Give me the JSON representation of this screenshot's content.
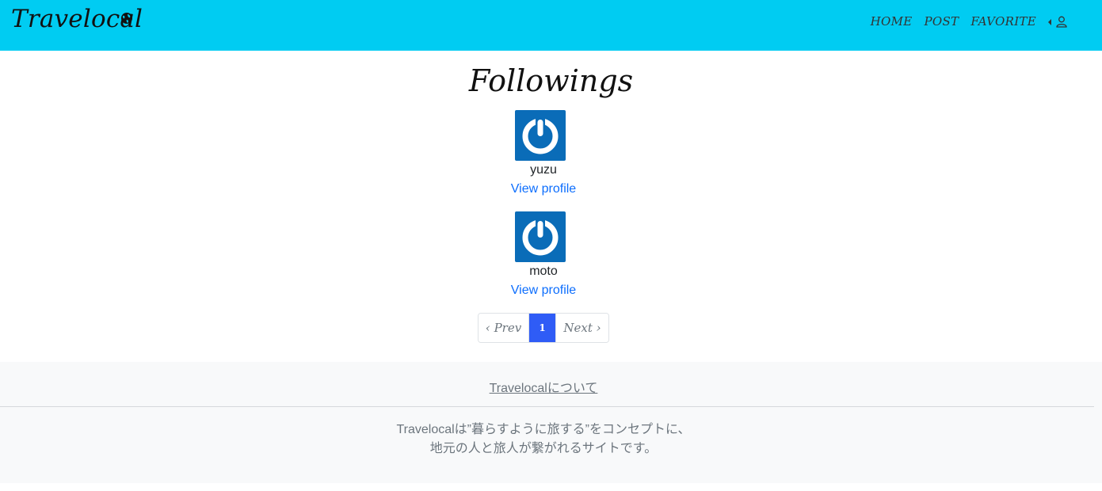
{
  "navbar": {
    "brand": "Travelocal",
    "brand_icon": "globe-icon",
    "links": [
      "HOME",
      "POST",
      "FAVORITE"
    ],
    "user_icon": "user-icon",
    "user_caret_icon": "caret-left-icon",
    "bg_color": "#00ccf2"
  },
  "page": {
    "title": "Followings"
  },
  "followings": [
    {
      "name": "yuzu",
      "link_label": "View profile",
      "avatar_icon": "power-icon"
    },
    {
      "name": "moto",
      "link_label": "View profile",
      "avatar_icon": "power-icon"
    }
  ],
  "pagination": {
    "prev": "‹ Prev",
    "current": "1",
    "next": "Next ›",
    "active_color": "#2f5cf6"
  },
  "footer": {
    "about_link": "Travelocalについて",
    "description_line1": "Travelocalは”暮らすように旅する”をコンセプトに、",
    "description_line2": "地元の人と旅人が繋がれるサイトです。"
  },
  "colors": {
    "link": "#0d6efd",
    "avatar_bg": "#0a6cb8"
  }
}
